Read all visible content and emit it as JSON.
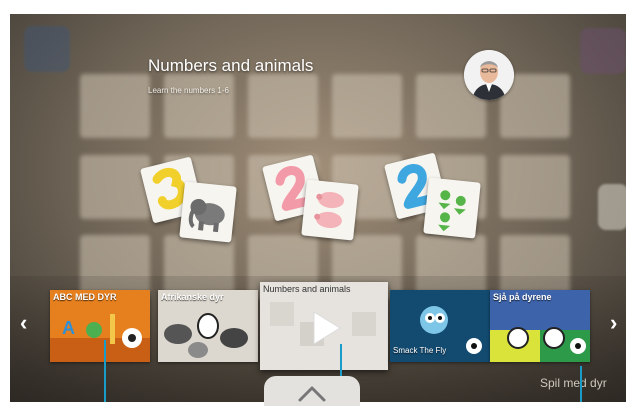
{
  "header": {
    "title": "Numbers and animals",
    "subtitle": "Learn the numbers 1-6"
  },
  "carousel": {
    "prev_icon": "chevron-left-icon",
    "next_icon": "chevron-right-icon",
    "games": [
      {
        "label": "ABC MED DYR"
      },
      {
        "label": "Afrikanske dyr"
      },
      {
        "label": "Numbers and animals",
        "selected": true
      },
      {
        "label": "Smack The Fly"
      },
      {
        "label": "Sjå på dyrene"
      }
    ],
    "next_game_hint": "Spil med dyr"
  },
  "home": {
    "icon": "house-icon"
  },
  "colors": {
    "pointer": "#1a9cc9",
    "card": "#f7f5f0"
  }
}
